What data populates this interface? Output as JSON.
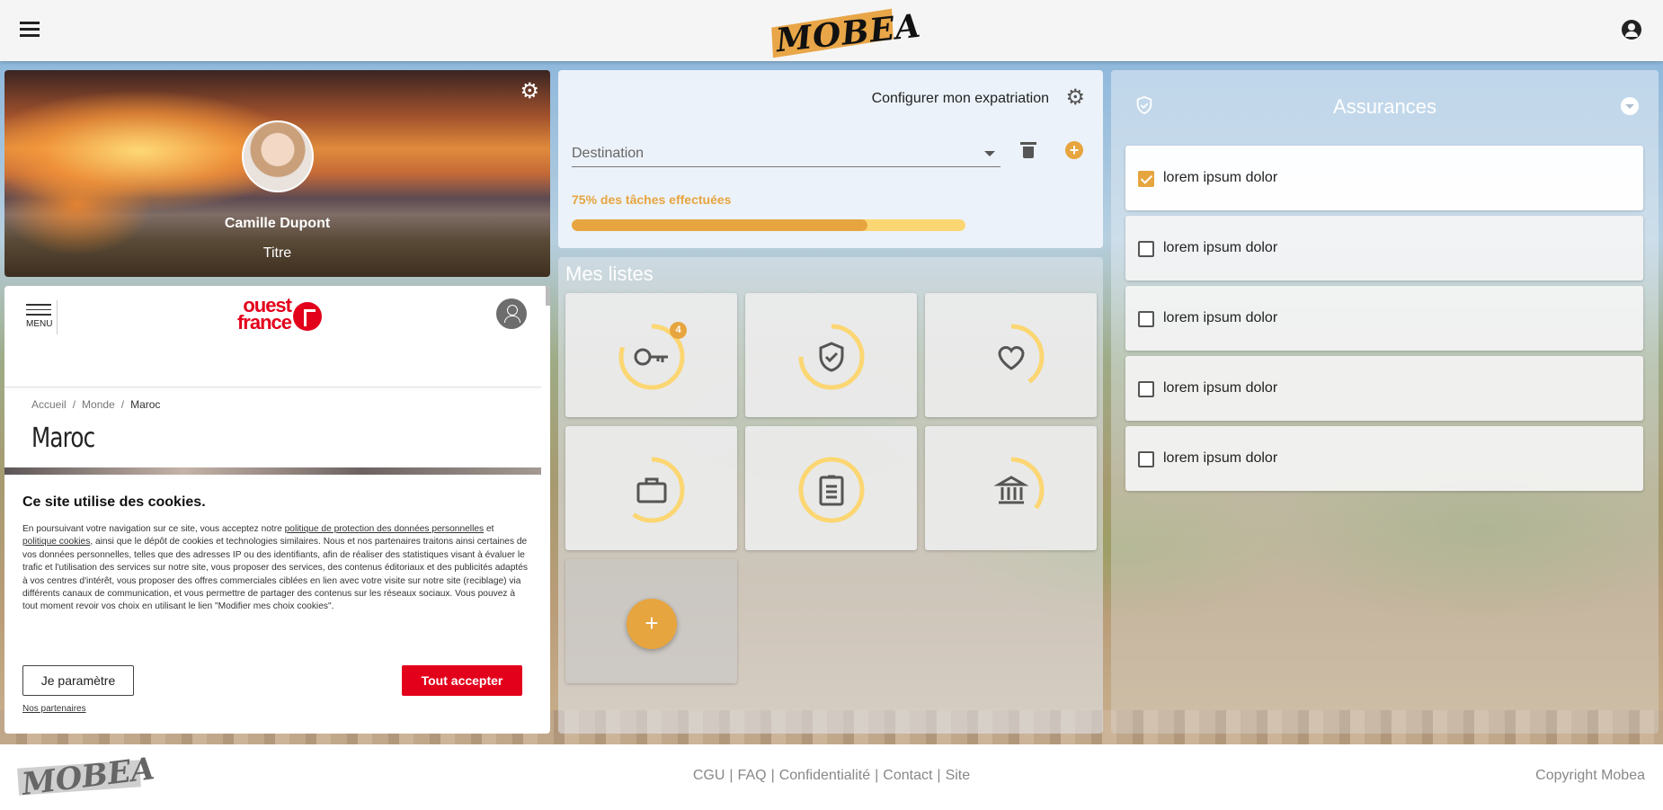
{
  "header": {
    "logo": "MOBEA",
    "menu_icon": "menu-icon",
    "account_icon": "account-circle-icon"
  },
  "profile": {
    "name": "Camille Dupont",
    "title": "Titre",
    "settings_icon": "gear-icon"
  },
  "embed": {
    "menu_label": "MENU",
    "logo_text": "ouest france",
    "breadcrumb": [
      "Accueil",
      "Monde",
      "Maroc"
    ],
    "heading": "Maroc",
    "cookie": {
      "title": "Ce site utilise des cookies.",
      "text_1": "En poursuivant votre navigation sur ce site, vous acceptez notre ",
      "link_1": "politique de protection des données personnelles",
      "text_2": " et ",
      "link_2": "politique cookies",
      "text_3": ", ainsi que le dépôt de cookies et technologies similaires. Nous et nos partenaires traitons ainsi certaines de vos données personnelles, telles que des adresses IP ou des identifiants, afin de réaliser des statistiques visant à évaluer le trafic et l'utilisation des services sur notre site, vous proposer des services, des contenus éditoriaux et des publicités adaptés à vos centres d'intérêt, vous proposer des offres commerciales ciblées en lien avec votre visite sur notre site (reciblage) via différents canaux de communication, et vous permettre de partager des contenus sur les réseaux sociaux. Vous pouvez à tout moment revoir vos choix en utilisant le lien \"Modifier mes choix cookies\".",
      "settings_button": "Je paramètre",
      "accept_button": "Tout accepter",
      "partners_link": "Nos partenaires"
    }
  },
  "config": {
    "label": "Configurer mon expatriation",
    "destination_placeholder": "Destination",
    "progress_text": "75% des tâches effectuées",
    "progress": 0.75
  },
  "lists": {
    "title": "Mes listes",
    "tiles": [
      {
        "icon": "key-icon",
        "progress": 0.8,
        "badge": "4"
      },
      {
        "icon": "shield-check-icon",
        "progress": 0.75
      },
      {
        "icon": "heart-icon",
        "progress": 0.4
      },
      {
        "icon": "briefcase-icon",
        "progress": 0.6
      },
      {
        "icon": "clipboard-icon",
        "progress": 1.0
      },
      {
        "icon": "bank-icon",
        "progress": 0.35
      }
    ],
    "add_label": "+"
  },
  "insurances": {
    "title": "Assurances",
    "items": [
      {
        "label": "lorem ipsum dolor",
        "checked": true
      },
      {
        "label": "lorem ipsum dolor",
        "checked": false
      },
      {
        "label": "lorem ipsum dolor",
        "checked": false
      },
      {
        "label": "lorem ipsum dolor",
        "checked": false
      },
      {
        "label": "lorem ipsum dolor",
        "checked": false
      }
    ]
  },
  "footer": {
    "logo": "MOBEA",
    "links": [
      "CGU",
      "FAQ",
      "Confidentialité",
      "Contact",
      "Site"
    ],
    "copyright": "Copyright Mobea"
  },
  "colors": {
    "accent": "#e7a53f",
    "accent_light": "#fcd672",
    "ouest_france_red": "#e3001b"
  }
}
